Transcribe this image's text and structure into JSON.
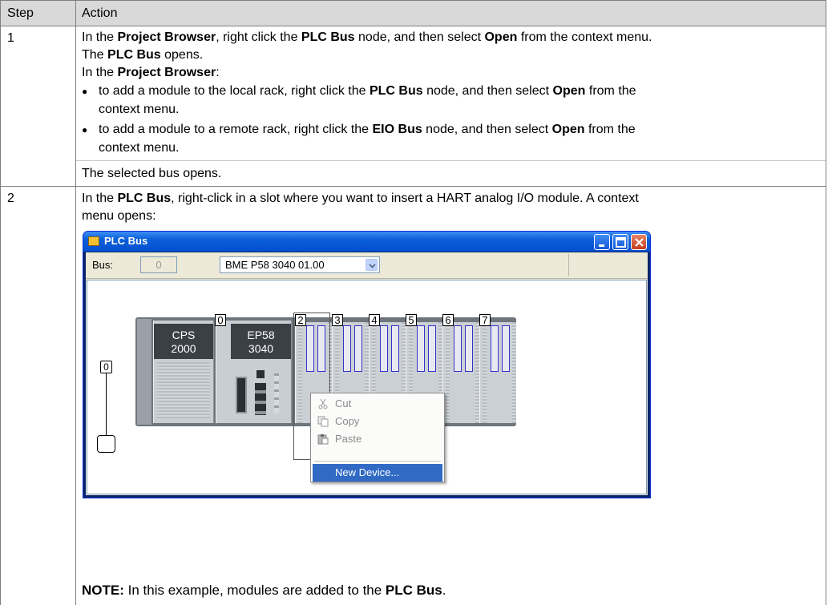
{
  "table": {
    "headers": {
      "step": "Step",
      "action": "Action"
    },
    "rows": [
      {
        "step": "1",
        "line1": [
          "In the ",
          "Project Browser",
          ", right click the ",
          "PLC Bus",
          " node, and then select ",
          "Open",
          " from the context menu."
        ],
        "line2": [
          "The ",
          "PLC Bus",
          " opens."
        ],
        "line3": [
          "In the ",
          "Project Browser",
          ":"
        ],
        "bullet1a": [
          "to add a module to the local rack, right click the ",
          "PLC Bus",
          " node, and then select ",
          "Open",
          " from the"
        ],
        "bullet1b": "context menu.",
        "bullet2a": [
          "to add a module to a remote rack, right click the ",
          "EIO Bus",
          " node, and then select ",
          "Open",
          " from the"
        ],
        "bullet2b": "context menu.",
        "footer": "The selected bus opens."
      },
      {
        "step": "2",
        "line1": [
          "In the ",
          "PLC Bus",
          ", right-click in a slot where you want to insert a HART analog I/O module. A context"
        ],
        "line2": "menu opens:",
        "note": [
          "NOTE:",
          " In this example, modules are added to the ",
          "PLC Bus",
          "."
        ]
      }
    ],
    "bullet_char": "●"
  },
  "window": {
    "title": "PLC Bus",
    "bus_label": "Bus:",
    "bus_value": "0",
    "cpu_select": "BME P58 3040 01.00",
    "title_buttons": [
      "minimize-icon",
      "maximize-icon",
      "close-icon"
    ]
  },
  "rack": {
    "rack_number": "0",
    "modules": [
      {
        "slot": "",
        "line1": "CPS",
        "line2": "2000"
      },
      {
        "slot": "0",
        "line1": "EP58",
        "line2": "3040"
      }
    ],
    "empty_slots": [
      "2",
      "3",
      "4",
      "5",
      "6",
      "7"
    ]
  },
  "context_menu": {
    "items": [
      {
        "label": "Cut",
        "icon": "scissors-icon"
      },
      {
        "label": "Copy",
        "icon": "copy-icon"
      },
      {
        "label": "Paste",
        "icon": "paste-icon"
      },
      {
        "label": "New Device...",
        "icon": ""
      }
    ]
  },
  "colors": {
    "header_bg": "#d9d9d9",
    "titlebar": "#0a5fd8",
    "selection": "#316ac5"
  }
}
